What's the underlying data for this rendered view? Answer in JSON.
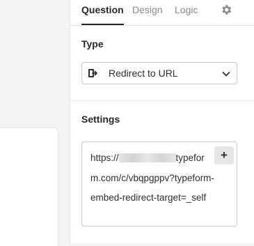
{
  "panel": {
    "tabs": [
      {
        "label": "Question",
        "active": true
      },
      {
        "label": "Design",
        "active": false
      },
      {
        "label": "Logic",
        "active": false
      }
    ],
    "settings_icon": "gear-icon"
  },
  "type_section": {
    "title": "Type",
    "selected": "Redirect to URL",
    "icon": "redirect-icon"
  },
  "settings_section": {
    "title": "Settings",
    "url_lines": [
      "https://",
      "typefor",
      "m.com/c/vbqpgppv?",
      "typeform-embed-redirect-",
      "target=_self"
    ],
    "insert_variable_label": "+"
  }
}
